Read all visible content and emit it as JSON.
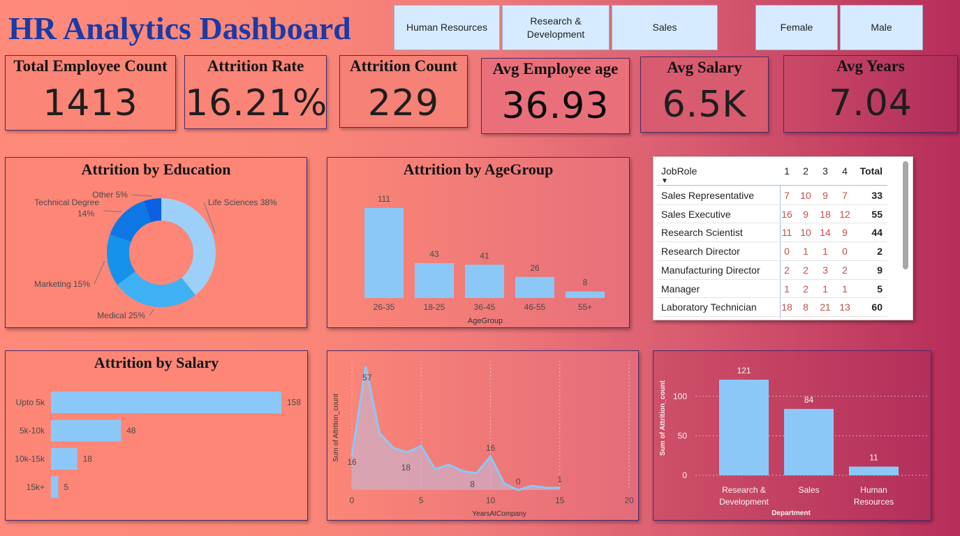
{
  "title": "HR Analytics Dashboard",
  "slicers": {
    "department": [
      "Human Resources",
      "Research &\nDevelopment",
      "Sales"
    ],
    "gender": [
      "Female",
      "Male"
    ]
  },
  "kpis": [
    {
      "label": "Total Employee Count",
      "value": "1413"
    },
    {
      "label": "Attrition Rate",
      "value": "16.21%"
    },
    {
      "label": "Attrition Count",
      "value": "229"
    },
    {
      "label": "Avg Employee age",
      "value": "36.93"
    },
    {
      "label": "Avg Salary",
      "value": "6.5K"
    },
    {
      "label": "Avg Years",
      "value": "7.04"
    }
  ],
  "colors": {
    "bar": "#8cc8f7",
    "donut": [
      "#9dd0f8",
      "#40b0f4",
      "#1592ec",
      "#0d78e4",
      "#0a60e0"
    ],
    "title_blue": "#1a3aa8",
    "matrix_number": "#c0504d"
  },
  "chart_data": [
    {
      "type": "pie",
      "title": "Attrition by Education",
      "categories": [
        "Life Sciences",
        "Medical",
        "Marketing",
        "Technical Degree",
        "Other"
      ],
      "values": [
        38,
        25,
        15,
        14,
        5
      ],
      "labels": [
        "Life Sciences 38%",
        "Medical 25%",
        "Marketing 15%",
        "Technical Degree 14%",
        "Other 5%"
      ]
    },
    {
      "type": "bar",
      "title": "Attrition by AgeGroup",
      "categories": [
        "26-35",
        "18-25",
        "36-45",
        "46-55",
        "55+"
      ],
      "values": [
        111,
        43,
        41,
        26,
        8
      ],
      "xlabel": "AgeGroup",
      "ylim": [
        0,
        111
      ]
    },
    {
      "type": "bar",
      "orientation": "horizontal",
      "title": "Attrition by Salary",
      "categories": [
        "Upto 5k",
        "5k-10k",
        "10k-15k",
        "15k+"
      ],
      "values": [
        158,
        48,
        18,
        5
      ],
      "xlim": [
        0,
        158
      ]
    },
    {
      "type": "area",
      "title": "",
      "xlabel": "YearsAtCompany",
      "ylabel": "Sum of Attrition_count",
      "x": [
        0,
        1,
        2,
        3,
        4,
        5,
        6,
        7,
        8,
        9,
        10,
        11,
        12,
        13,
        14,
        15
      ],
      "y": [
        16,
        59,
        27,
        20,
        18,
        21,
        10,
        12,
        9,
        8,
        16,
        3,
        0,
        2,
        1,
        1
      ],
      "data_labels": [
        {
          "x": 0,
          "text": "16"
        },
        {
          "x": 1,
          "text": "57"
        },
        {
          "x": 4,
          "text": "18"
        },
        {
          "x": 9,
          "text": "8"
        },
        {
          "x": 10,
          "text": "16"
        },
        {
          "x": 12,
          "text": "0"
        },
        {
          "x": 15,
          "text": "1"
        }
      ],
      "xticks": [
        "0",
        "5",
        "10",
        "15",
        "20"
      ],
      "xlim": [
        0,
        20
      ],
      "ylim": [
        0,
        59
      ],
      "grid": "vertical dotted"
    },
    {
      "type": "bar",
      "title": "",
      "categories": [
        "Research &\nDevelopment",
        "Sales",
        "Human\nResources"
      ],
      "values": [
        121,
        84,
        11
      ],
      "xlabel": "Department",
      "ylabel": "Sum of Attrition_count",
      "yticks": [
        "0",
        "50",
        "100"
      ],
      "ylim": [
        0,
        121
      ],
      "grid": "horizontal dotted"
    }
  ],
  "matrix": {
    "row_header": "JobRole",
    "columns": [
      "1",
      "2",
      "3",
      "4",
      "Total"
    ],
    "rows": [
      {
        "role": "Sales Representative",
        "values": [
          "7",
          "10",
          "9",
          "7"
        ],
        "total": "33"
      },
      {
        "role": "Sales Executive",
        "values": [
          "16",
          "9",
          "18",
          "12"
        ],
        "total": "55"
      },
      {
        "role": "Research Scientist",
        "values": [
          "11",
          "10",
          "14",
          "9"
        ],
        "total": "44"
      },
      {
        "role": "Research Director",
        "values": [
          "0",
          "1",
          "1",
          "0"
        ],
        "total": "2"
      },
      {
        "role": "Manufacturing Director",
        "values": [
          "2",
          "2",
          "3",
          "2"
        ],
        "total": "9"
      },
      {
        "role": "Manager",
        "values": [
          "1",
          "2",
          "1",
          "1"
        ],
        "total": "5"
      },
      {
        "role": "Laboratory Technician",
        "values": [
          "18",
          "8",
          "21",
          "13"
        ],
        "total": "60"
      }
    ]
  }
}
